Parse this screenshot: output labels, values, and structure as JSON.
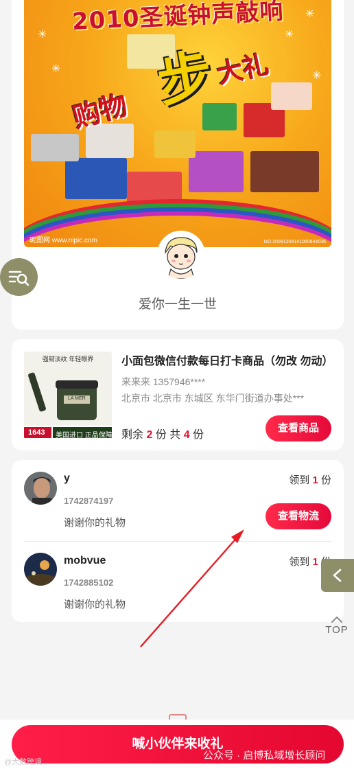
{
  "hero": {
    "poster_title": "2010圣诞钟声敲响",
    "poster_big_char": "步",
    "poster_left_words": "购物",
    "poster_right_words": "大礼",
    "poster_watermark_left": "昵图网 www.nipic.com",
    "poster_watermark_right": "NO.20091204141060644036",
    "name": "爱你一生一世"
  },
  "product": {
    "title": "小面包微信付款每日打卡商品（勿改 勿动）",
    "seller": "来来来  1357946****",
    "address": "北京市 北京市 东城区 东华门街道办事处***",
    "stock_prefix": "剩余",
    "stock_remaining": "2",
    "stock_mid": "份 共",
    "stock_total": "4",
    "stock_suffix": "份",
    "img_tagline": "强韧淡纹 年轻眼界",
    "img_brand": "LA MER",
    "img_price": "1643",
    "img_badge": "美国进口 正品保障",
    "view_button": "查看商品"
  },
  "recipients": [
    {
      "name": "y",
      "phone": "1742874197",
      "message": "谢谢你的礼物",
      "claim_prefix": "领到",
      "claim_count": "1",
      "claim_suffix": "份",
      "action_button": "查看物流"
    },
    {
      "name": "mobvue",
      "phone": "1742885102",
      "message": "谢谢你的礼物",
      "claim_prefix": "领到",
      "claim_count": "1",
      "claim_suffix": "份"
    }
  ],
  "floating": {
    "top_label": "TOP",
    "search_icon": "search-list-icon",
    "back_icon": "chevron-left-icon"
  },
  "bottom": {
    "cta_label": "喊小伙伴来收礼",
    "watermark_left": "@大数跨境",
    "watermark_right": "公众号 · 启博私域增长顾问"
  },
  "colors": {
    "accent": "#e8102e",
    "fab": "#8e8e68",
    "background": "#f4f4f4"
  }
}
